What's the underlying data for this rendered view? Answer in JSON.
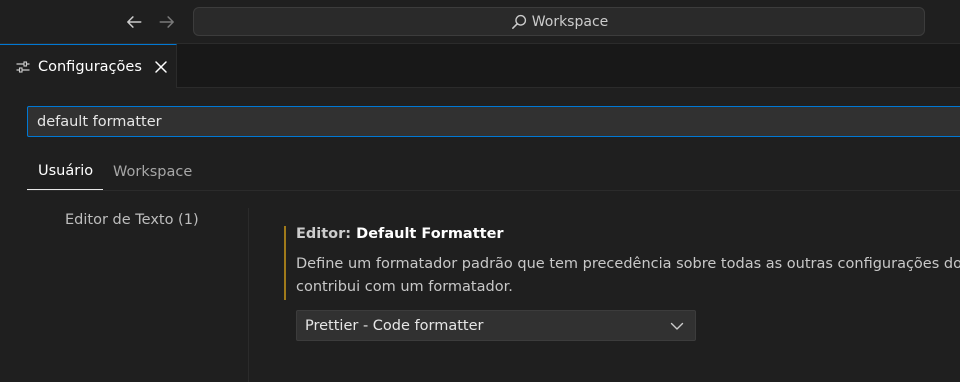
{
  "titlebar": {
    "command_center_label": "Workspace",
    "back_icon": "arrow-left-icon",
    "forward_icon": "arrow-right-icon",
    "search_icon": "search-icon"
  },
  "editor_tab": {
    "label": "Configurações",
    "icon": "settings-sliders-icon",
    "close_icon": "close-icon"
  },
  "search": {
    "value": "default formatter"
  },
  "scope_tabs": [
    {
      "label": "Usuário",
      "active": true
    },
    {
      "label": "Workspace",
      "active": false
    }
  ],
  "toc": {
    "items": [
      {
        "label": "Editor de Texto (1)"
      }
    ]
  },
  "setting": {
    "category": "Editor: ",
    "name": "Default Formatter",
    "description_line1": "Define um formatador padrão que tem precedência sobre todas as outras configurações do f",
    "description_line2": "contribui com um formatador.",
    "selected_value": "Prettier - Code formatter",
    "chevron_icon": "chevron-down-icon"
  },
  "colors": {
    "accent": "#0078d4",
    "modified_indicator": "#a07a1a",
    "background": "#1f1f1f"
  }
}
